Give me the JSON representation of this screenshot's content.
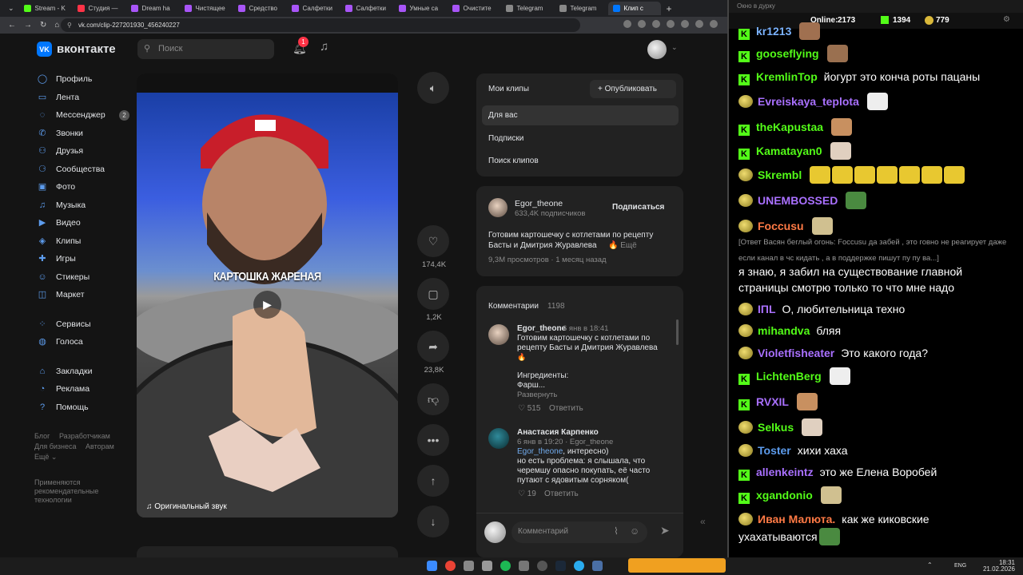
{
  "browser": {
    "tabs": [
      {
        "label": "Stream - K",
        "color": "#53fc18"
      },
      {
        "label": "Студия —",
        "color": "#ff3347"
      },
      {
        "label": "Dream ha",
        "color": "#a855f7"
      },
      {
        "label": "Чистящее",
        "color": "#a855f7"
      },
      {
        "label": "Средство",
        "color": "#a855f7"
      },
      {
        "label": "Салфетки",
        "color": "#a855f7"
      },
      {
        "label": "Салфетки",
        "color": "#a855f7"
      },
      {
        "label": "Умные са",
        "color": "#a855f7"
      },
      {
        "label": "Очистите",
        "color": "#a855f7"
      },
      {
        "label": "Telegram",
        "color": "#888888"
      },
      {
        "label": "Telegram",
        "color": "#888888"
      },
      {
        "label": "Клип с",
        "color": "#0077ff"
      }
    ],
    "url": "vk.com/clip-227201930_456240227"
  },
  "vk": {
    "logo": "вконтакте",
    "search_placeholder": "Поиск",
    "notif_count": "1",
    "sidebar": [
      {
        "label": "Профиль",
        "icon": "user-icon",
        "glyph": "◯"
      },
      {
        "label": "Лента",
        "icon": "news-icon",
        "glyph": "▭"
      },
      {
        "label": "Мессенджер",
        "icon": "chat-icon",
        "glyph": "◌",
        "badge": "2"
      },
      {
        "label": "Звонки",
        "icon": "phone-icon",
        "glyph": "✆"
      },
      {
        "label": "Друзья",
        "icon": "friends-icon",
        "glyph": "⚇"
      },
      {
        "label": "Сообщества",
        "icon": "groups-icon",
        "glyph": "⚆"
      },
      {
        "label": "Фото",
        "icon": "photo-icon",
        "glyph": "▣"
      },
      {
        "label": "Музыка",
        "icon": "music-icon",
        "glyph": "♫"
      },
      {
        "label": "Видео",
        "icon": "video-icon",
        "glyph": "▶"
      },
      {
        "label": "Клипы",
        "icon": "clips-icon",
        "glyph": "◈"
      },
      {
        "label": "Игры",
        "icon": "games-icon",
        "glyph": "✚"
      },
      {
        "label": "Стикеры",
        "icon": "stickers-icon",
        "glyph": "☺"
      },
      {
        "label": "Маркет",
        "icon": "market-icon",
        "glyph": "◫"
      }
    ],
    "sidebar2": [
      {
        "label": "Сервисы",
        "icon": "services-icon",
        "glyph": "⁘"
      },
      {
        "label": "Голоса",
        "icon": "votes-icon",
        "glyph": "◍"
      }
    ],
    "sidebar3": [
      {
        "label": "Закладки",
        "icon": "bookmark-icon",
        "glyph": "⌂"
      },
      {
        "label": "Реклама",
        "icon": "ads-icon",
        "glyph": "◔"
      },
      {
        "label": "Помощь",
        "icon": "help-icon",
        "glyph": "?"
      }
    ],
    "footer_links": [
      "Блог",
      "Разработчикам",
      "Для бизнеса",
      "Авторам",
      "Ещё ⌄"
    ],
    "footer_note": "Применяются рекомендательные технологии",
    "video": {
      "caption": "КАРТОШКА ЖАРЕНАЯ",
      "sound": "♫  Оригинальный звук",
      "progress": 0.07
    },
    "actions": {
      "likes": "174,4K",
      "comments": "1,2K",
      "shares": "23,8K"
    },
    "clips_menu": {
      "my_clips": "Мои клипы",
      "publish": "+  Опубликовать",
      "items": [
        "Для вас",
        "Подписки",
        "Поиск клипов"
      ]
    },
    "author": {
      "name": "Egor_theone",
      "subscribers": "633,4K подписчиков",
      "subscribe": "Подписаться",
      "description_1": "Готовим картошечку с котлетами по рецепту",
      "description_2": "Басты и Дмитрия Журавлева",
      "more": "🔥 Ещё",
      "meta": "9,3M просмотров · 1 месяц назад"
    },
    "comments": {
      "title": "Комментарии",
      "count": "1198",
      "c1": {
        "name": "Egor_theone",
        "time": "6 янв в 18:41",
        "text1": "Готовим картошечку с котлетами по",
        "text2": "рецепту Басты и Дмитрия Журавлева",
        "text3": "🔥",
        "text4": "Ингредиенты:",
        "text5": "Фарш...",
        "expand": "Развернуть",
        "likes": "♡  515",
        "reply": "Ответить"
      },
      "c2": {
        "name": "Анастасия Карпенко",
        "time": "6 янв в 19:20 · Egor_theone",
        "mention": "Egor_theone",
        "text_after": ", интересно)",
        "text2": "но есть проблема: я слышала, что",
        "text3": "черемшу опасно покупать, её часто",
        "text4": "путают с ядовитым сорняком(",
        "likes": "♡  19",
        "reply": "Ответить"
      },
      "input_placeholder": "Комментарий"
    }
  },
  "chat": {
    "window_title": "Окно в дурку",
    "online_label": "Online:",
    "online": "2173",
    "stat2": "1394",
    "stat3": "779",
    "messages": [
      {
        "name": "kr1213",
        "color": "#7bb3ff",
        "text": "",
        "badge": "k"
      },
      {
        "name": "gooseflying",
        "color": "#53fc18",
        "text": "",
        "badge": "k"
      },
      {
        "name": "KremlinTop",
        "color": "#53fc18",
        "text": "йогурт это конча роты пацаны",
        "badge": "k"
      },
      {
        "name": "Evreiskaya_teplota",
        "color": "#a970ff",
        "text": "",
        "badge": "em"
      },
      {
        "name": "theKapustaa",
        "color": "#53fc18",
        "text": "",
        "badge": "k"
      },
      {
        "name": "Kamatayan0",
        "color": "#53fc18",
        "text": "",
        "badge": "k"
      },
      {
        "name": "Skrembl",
        "color": "#53fc18",
        "text": "",
        "badge": "em"
      },
      {
        "name": "UNEMBOSSED",
        "color": "#a970ff",
        "text": "",
        "badge": "em"
      },
      {
        "name": "Foccusu",
        "color": "#ff7a45",
        "text": "",
        "badge": "em"
      }
    ],
    "reply_text": "[Ответ Васян беглый огонь: Foccusu да забей , это говно не реагирует даже если канал в чс кидать , а в поддержке пишут пу пу ва...]",
    "foccusu_msg": "я знаю, я забил на существование главной страницы смотрю только то что мне надо",
    "messages2": [
      {
        "name": "IПL",
        "color": "#a970ff",
        "text": "О, любительница техно",
        "badge": "em"
      },
      {
        "name": "mihandva",
        "color": "#53fc18",
        "text": "бляя",
        "badge": "em"
      },
      {
        "name": "Violetfisheater",
        "color": "#a970ff",
        "text": "Это какого года?",
        "badge": "em"
      },
      {
        "name": "LichtenBerg",
        "color": "#53fc18",
        "text": "",
        "badge": "k"
      },
      {
        "name": "RVXIL",
        "color": "#a970ff",
        "text": "",
        "badge": "k"
      },
      {
        "name": "Selkus",
        "color": "#53fc18",
        "text": "",
        "badge": "em"
      },
      {
        "name": "Toster",
        "color": "#5d9ced",
        "text": "хихи хаха",
        "badge": "em"
      },
      {
        "name": "allenkeintz",
        "color": "#a970ff",
        "text": "это же Елена Воробей",
        "badge": "k"
      },
      {
        "name": "xgandonio",
        "color": "#53fc18",
        "text": "",
        "badge": "k"
      },
      {
        "name": "Иван Малюта.",
        "color": "#ff7a45",
        "text": "как же киковские",
        "badge": "em"
      }
    ],
    "last_line": "ухахатываются"
  },
  "taskbar": {
    "lang": "ENG",
    "time": "18:31",
    "date": "21.02.2026"
  }
}
